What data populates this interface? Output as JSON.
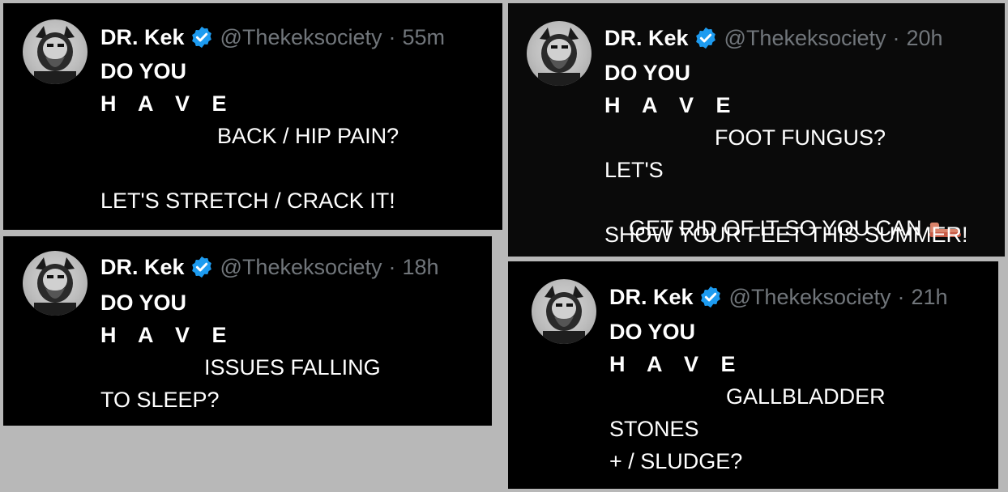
{
  "tweets": [
    {
      "name": "DR. Kek",
      "handle": "@Thekeksociety",
      "separator": "·",
      "time": "55m",
      "line1": "DO YOU",
      "line2": "H A V E",
      "line3": "BACK / HIP PAIN?",
      "line4": "LET'S STRETCH / CRACK IT!"
    },
    {
      "name": "DR. Kek",
      "handle": "@Thekeksociety",
      "separator": "·",
      "time": "18h",
      "line1": "DO YOU",
      "line2": "H A V E",
      "line3": "ISSUES FALLING",
      "line4": "TO SLEEP?"
    },
    {
      "name": "DR. Kek",
      "handle": "@Thekeksociety",
      "separator": "·",
      "time": "20h",
      "line1": "DO YOU",
      "line2": "H A V E",
      "line3": "FOOT FUNGUS?",
      "line4": "LET'S",
      "line5": "GET RID OF IT SO YOU CAN",
      "line6": "SHOW YOUR FEET THIS SUMMER!"
    },
    {
      "name": "DR. Kek",
      "handle": "@Thekeksociety",
      "separator": "·",
      "time": "21h",
      "line1": "DO YOU",
      "line2": "H A V E",
      "line3": "GALLBLADDER",
      "line4": "STONES",
      "line5": "+ / SLUDGE?"
    }
  ],
  "icons": {
    "verified": "verified-badge-icon",
    "emoji": "foot-emoji-icon"
  },
  "colors": {
    "background": "#b8b8b8",
    "card": "#000000",
    "text": "#ffffff",
    "muted": "#71767b",
    "verified": "#1d9bf0"
  }
}
